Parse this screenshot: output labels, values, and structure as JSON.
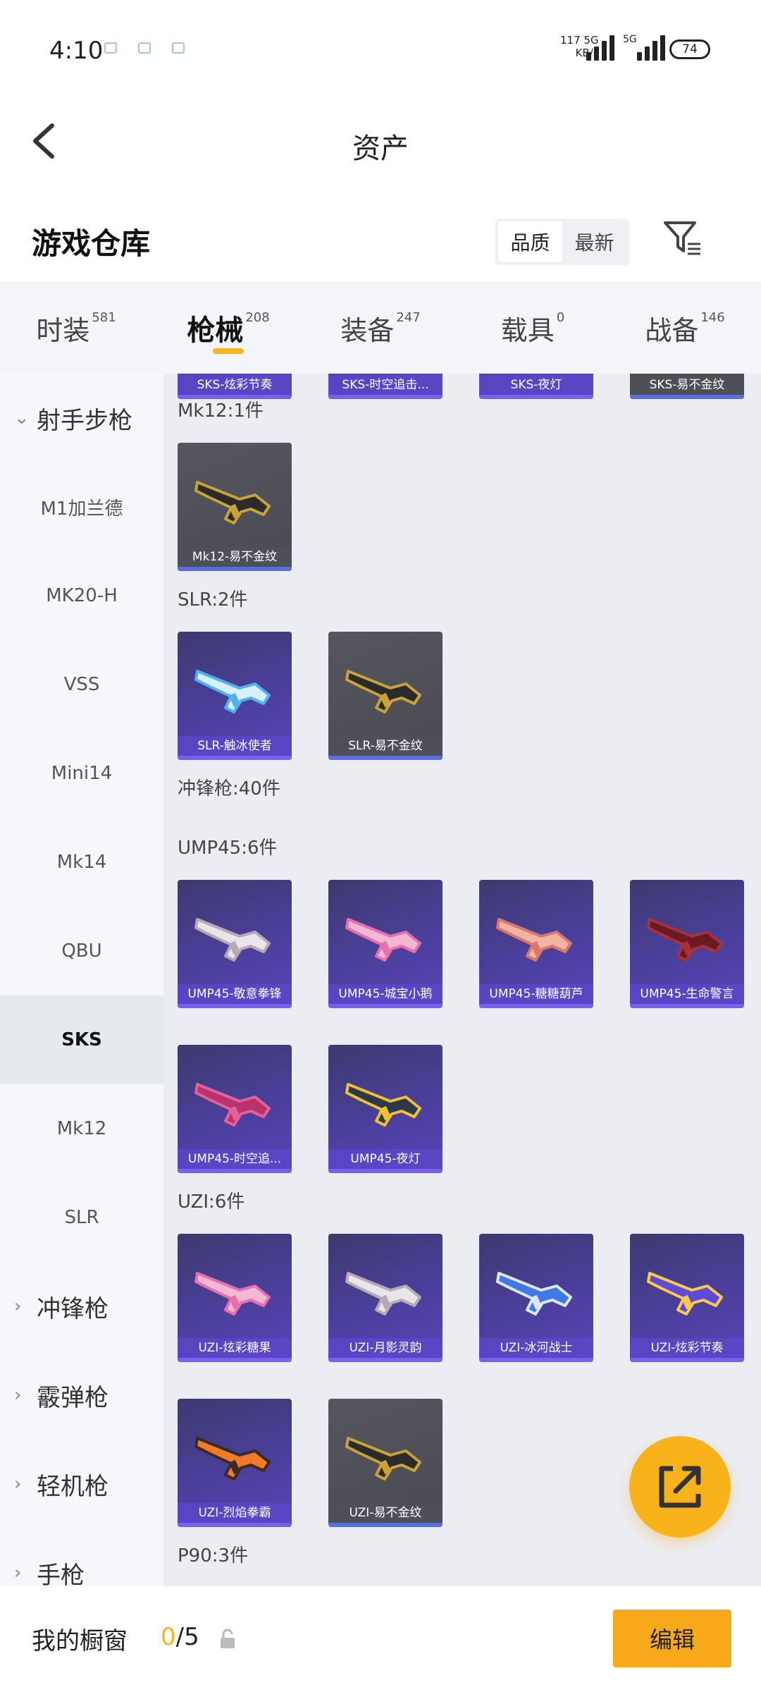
{
  "status_bar": {
    "time": "4:10",
    "rate_top": "117 5G",
    "rate_bottom": "KB/s",
    "net2": "5G",
    "battery": "74"
  },
  "header": {
    "title": "资产"
  },
  "section": {
    "title": "游戏仓库",
    "sort_options": [
      "品质",
      "最新"
    ],
    "active_sort": "品质"
  },
  "tabs": [
    {
      "label": "时装",
      "count": "581"
    },
    {
      "label": "枪械",
      "count": "208"
    },
    {
      "label": "装备",
      "count": "247"
    },
    {
      "label": "载具",
      "count": "0"
    },
    {
      "label": "战备",
      "count": "146"
    }
  ],
  "active_tab": "枪械",
  "sidebar": {
    "items": [
      {
        "label": "射手步枪",
        "type": "category",
        "chevron": "⌄"
      },
      {
        "label": "M1加兰德",
        "type": "sub"
      },
      {
        "label": "MK20-H",
        "type": "sub"
      },
      {
        "label": "VSS",
        "type": "sub"
      },
      {
        "label": "Mini14",
        "type": "sub"
      },
      {
        "label": "Mk14",
        "type": "sub"
      },
      {
        "label": "QBU",
        "type": "sub"
      },
      {
        "label": "SKS",
        "type": "sub",
        "selected": true
      },
      {
        "label": "Mk12",
        "type": "sub"
      },
      {
        "label": "SLR",
        "type": "sub"
      },
      {
        "label": "冲锋枪",
        "type": "category",
        "chevron": "›"
      },
      {
        "label": "霰弹枪",
        "type": "category",
        "chevron": "›"
      },
      {
        "label": "轻机枪",
        "type": "category",
        "chevron": "›"
      },
      {
        "label": "手枪",
        "type": "category",
        "chevron": "›"
      }
    ]
  },
  "content": {
    "top_row": [
      {
        "name": "SKS-炫彩节奏",
        "style": "purple"
      },
      {
        "name": "SKS-时空追击...",
        "style": "purple"
      },
      {
        "name": "SKS-夜灯",
        "style": "purple"
      },
      {
        "name": "SKS-易不金纹",
        "style": "gray"
      }
    ],
    "groups": [
      {
        "header": "Mk12:1件",
        "items": [
          {
            "name": "Mk12-易不金纹",
            "style": "gray",
            "gun": "gold"
          }
        ]
      },
      {
        "header": "SLR:2件",
        "items": [
          {
            "name": "SLR-触冰使者",
            "style": "purple",
            "gun": "ice"
          },
          {
            "name": "SLR-易不金纹",
            "style": "gray",
            "gun": "gold"
          }
        ]
      },
      {
        "header": "冲锋枪:40件",
        "items": []
      },
      {
        "header": "UMP45:6件",
        "items": [
          {
            "name": "UMP45-敬意拳锋",
            "style": "purple",
            "gun": "white"
          },
          {
            "name": "UMP45-城宝小鹅",
            "style": "purple",
            "gun": "pink"
          },
          {
            "name": "UMP45-糖糖葫芦",
            "style": "purple",
            "gun": "peach"
          },
          {
            "name": "UMP45-生命警言",
            "style": "purple",
            "gun": "red"
          },
          {
            "name": "UMP45-时空追...",
            "style": "purple",
            "gun": "magenta"
          },
          {
            "name": "UMP45-夜灯",
            "style": "purple",
            "gun": "teal"
          }
        ]
      },
      {
        "header": "UZI:6件",
        "items": [
          {
            "name": "UZI-炫彩糖果",
            "style": "purple",
            "gun": "pink"
          },
          {
            "name": "UZI-月影灵韵",
            "style": "purple",
            "gun": "white"
          },
          {
            "name": "UZI-冰河战士",
            "style": "purple",
            "gun": "blue"
          },
          {
            "name": "UZI-炫彩节奏",
            "style": "purple",
            "gun": "violet"
          },
          {
            "name": "UZI-烈焰拳霸",
            "style": "purple",
            "gun": "orange"
          },
          {
            "name": "UZI-易不金纹",
            "style": "gray",
            "gun": "gold"
          }
        ]
      },
      {
        "header": "P90:3件",
        "items": []
      }
    ]
  },
  "fab": {
    "icon": "share-external-icon"
  },
  "bottom_bar": {
    "label": "我的橱窗",
    "current": "0",
    "total": "/5",
    "edit": "编辑"
  },
  "colors": {
    "accent": "#f5b420",
    "card_purple": "#4b3f9c",
    "card_gray": "#4f4f57",
    "content_bg": "#ebedf2"
  }
}
